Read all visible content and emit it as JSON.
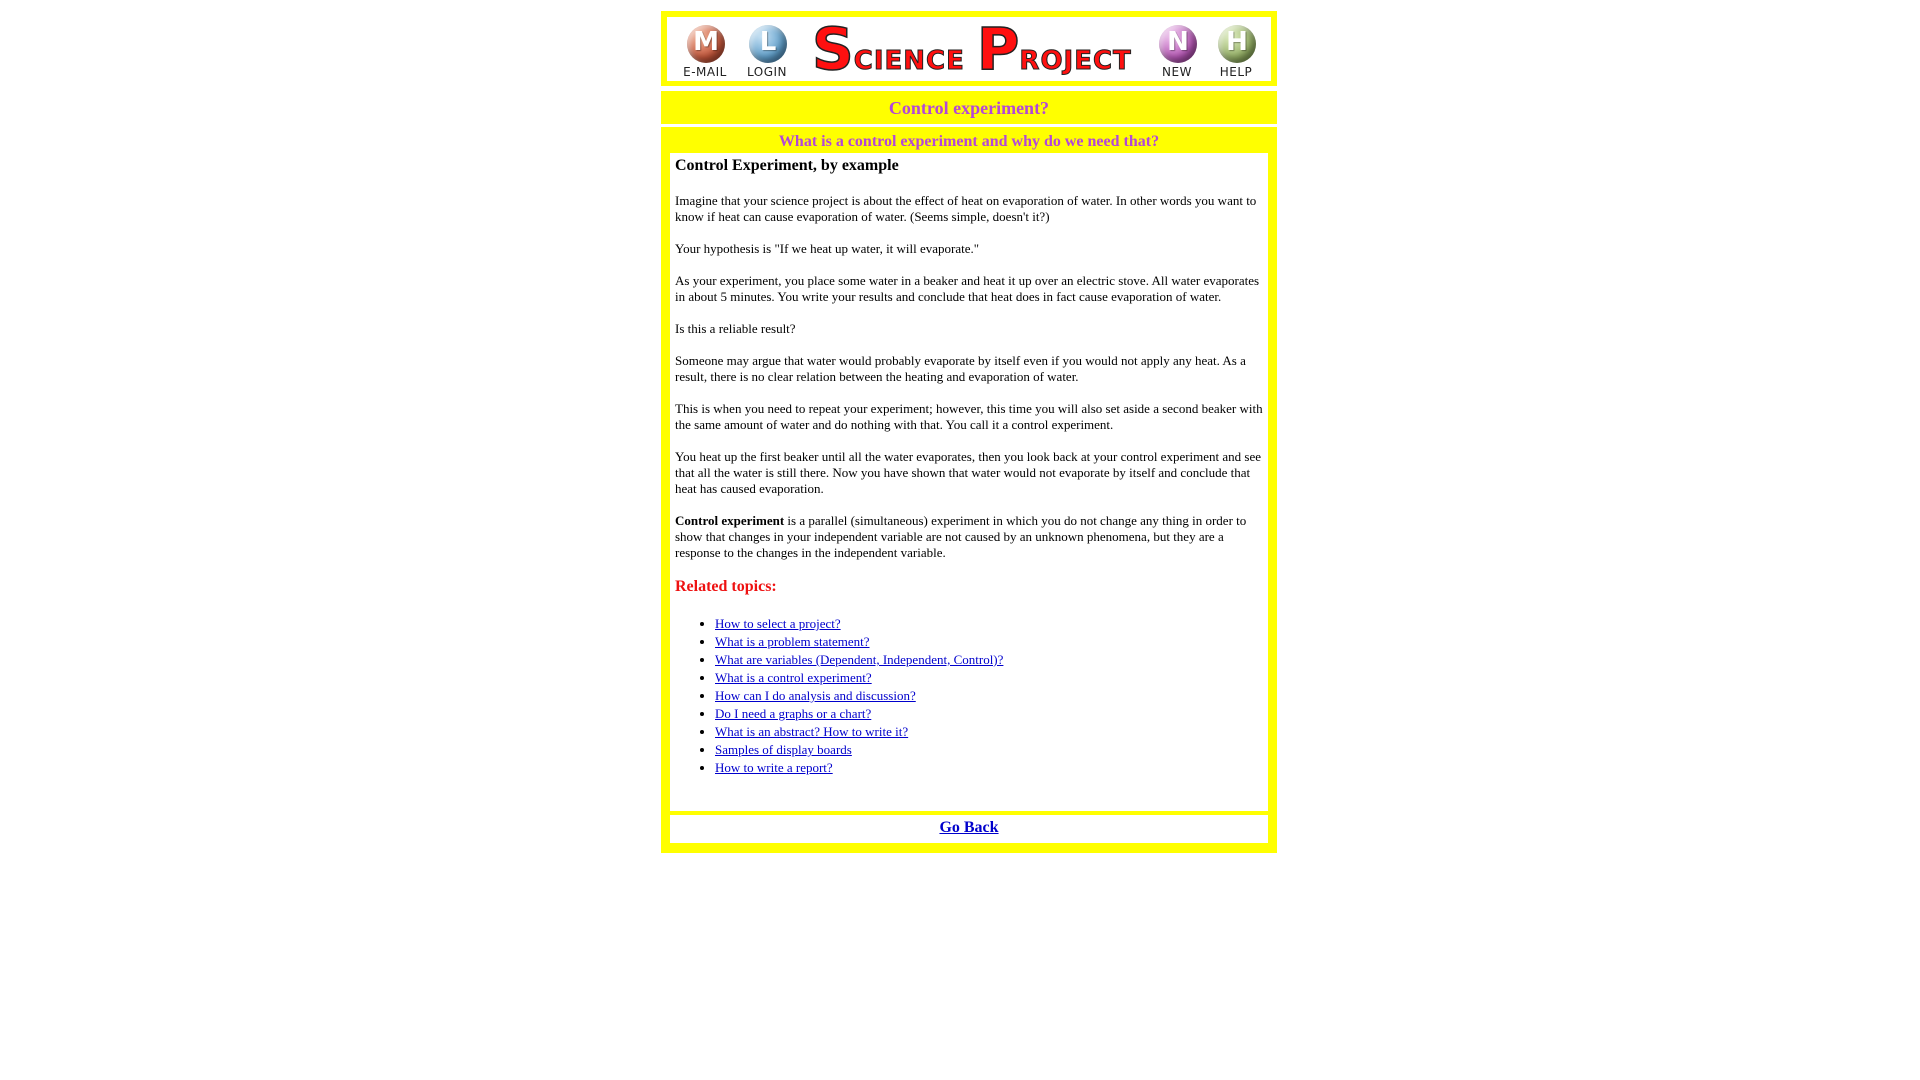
{
  "header": {
    "nav_left": [
      {
        "letter": "M",
        "label": "E-MAIL",
        "icon": "email-icon"
      },
      {
        "letter": "L",
        "label": "LOGIN",
        "icon": "login-icon"
      }
    ],
    "logo": {
      "s_big": "S",
      "s_rest": "CIENCE",
      "p_big": "P",
      "p_rest": "ROJECT"
    },
    "nav_right": [
      {
        "letter": "N",
        "label": "NEW",
        "icon": "new-icon"
      },
      {
        "letter": "H",
        "label": "HELP",
        "icon": "help-icon"
      }
    ]
  },
  "page_title": "Control experiment?",
  "subtitle": "What is a control experiment and why do we need that?",
  "article": {
    "heading": "Control Experiment, by example",
    "paragraphs": [
      "Imagine that your science project is about the effect of heat on evaporation of water. In other words you want to know if heat can cause evaporation of water. (Seems simple, doesn't it?)",
      "Your hypothesis is \"If we heat up water, it will evaporate.\"",
      "As your experiment, you place some water in a beaker and heat it up over an electric stove. All water evaporates in about 5 minutes. You write your results and conclude that heat does in fact cause evaporation of water.",
      "Is this a reliable result?",
      "Someone may argue that water would probably evaporate by itself even if you would not apply any heat. As a result, there is no clear relation between the heating and evaporation of water.",
      "This is when you need to repeat your experiment; however, this time you will also set aside a second beaker with the same amount of water and do nothing with that. You call it a control experiment.",
      "You heat up the first beaker until all the water evaporates, then you look back at your control experiment and see that all the water is still there. Now you have shown that water would not evaporate by itself and conclude that heat has caused evaporation."
    ],
    "definition_term": "Control experiment",
    "definition_text": " is a parallel (simultaneous) experiment in which you do not change any thing in order to show that changes in your independent variable are not caused by an unknown phenomena, but they are a response to the changes in the independent variable."
  },
  "related": {
    "heading": "Related topics:",
    "links": [
      "How to select a project?",
      "What is a problem statement?",
      "What are variables (Dependent, Independent, Control)?",
      "What is a control experiment?",
      "How can I do analysis and discussion?",
      "Do I need a graphs or a chart?",
      "What is an abstract? How to write it?",
      "Samples of display boards",
      "How to write a report?"
    ]
  },
  "go_back": "Go Back",
  "colors": {
    "banner": "#ffff00",
    "title": "#b347d9",
    "related_heading": "#ee1111",
    "link": "#0000cc"
  }
}
